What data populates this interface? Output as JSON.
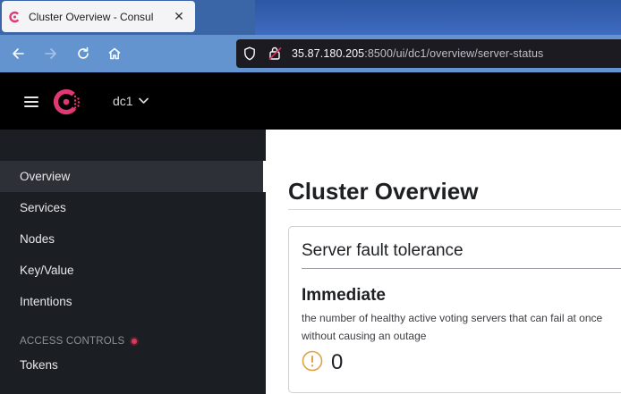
{
  "browser": {
    "tab_title": "Cluster Overview - Consul",
    "tab_close": "✕",
    "url_host": "35.87.180.205",
    "url_rest": ":8500/ui/dc1/overview/server-status"
  },
  "header": {
    "datacenter": "dc1"
  },
  "sidebar": {
    "items": [
      {
        "label": "Overview"
      },
      {
        "label": "Services"
      },
      {
        "label": "Nodes"
      },
      {
        "label": "Key/Value"
      },
      {
        "label": "Intentions"
      }
    ],
    "section_label": "ACCESS CONTROLS",
    "section_items": [
      {
        "label": "Tokens"
      }
    ]
  },
  "main": {
    "page_title": "Cluster Overview",
    "card_title": "Server fault tolerance",
    "immediate_title": "Immediate",
    "immediate_desc": "the number of healthy active voting servers that can fail at once without causing an outage",
    "immediate_count": "0"
  },
  "colors": {
    "consul_brand": "#e03875",
    "warning": "#e0a043",
    "sidebar_bg": "#1b1e23",
    "header_bg": "#000000"
  }
}
